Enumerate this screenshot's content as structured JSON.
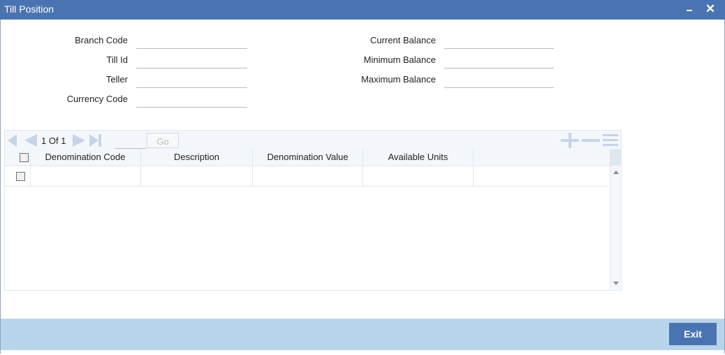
{
  "window": {
    "title": "Till Position",
    "close_glyph": "✕"
  },
  "form": {
    "branch_code": {
      "label": "Branch Code",
      "value": ""
    },
    "till_id": {
      "label": "Till Id",
      "value": ""
    },
    "teller": {
      "label": "Teller",
      "value": ""
    },
    "currency_code": {
      "label": "Currency Code",
      "value": ""
    },
    "current_balance": {
      "label": "Current Balance",
      "value": ""
    },
    "minimum_balance": {
      "label": "Minimum Balance",
      "value": ""
    },
    "maximum_balance": {
      "label": "Maximum Balance",
      "value": ""
    }
  },
  "grid": {
    "pagination": {
      "current": "1",
      "of_label": "Of",
      "total": "1",
      "page_input": "",
      "go_label": "Go"
    },
    "columns": [
      "Denomination Code",
      "Description",
      "Denomination Value",
      "Available Units"
    ],
    "rows": [
      {
        "denomination_code": "",
        "description": "",
        "denomination_value": "",
        "available_units": ""
      }
    ],
    "icons": [
      "first-page-icon",
      "prev-page-icon",
      "next-page-icon",
      "last-page-icon",
      "add-row-icon",
      "delete-row-icon",
      "single-view-icon"
    ]
  },
  "footer": {
    "exit_label": "Exit"
  },
  "colors": {
    "titlebar": "#4a74b1",
    "footer": "#b8d4ea",
    "button": "#4a74b1",
    "grid_header": "#f3f7fb"
  }
}
